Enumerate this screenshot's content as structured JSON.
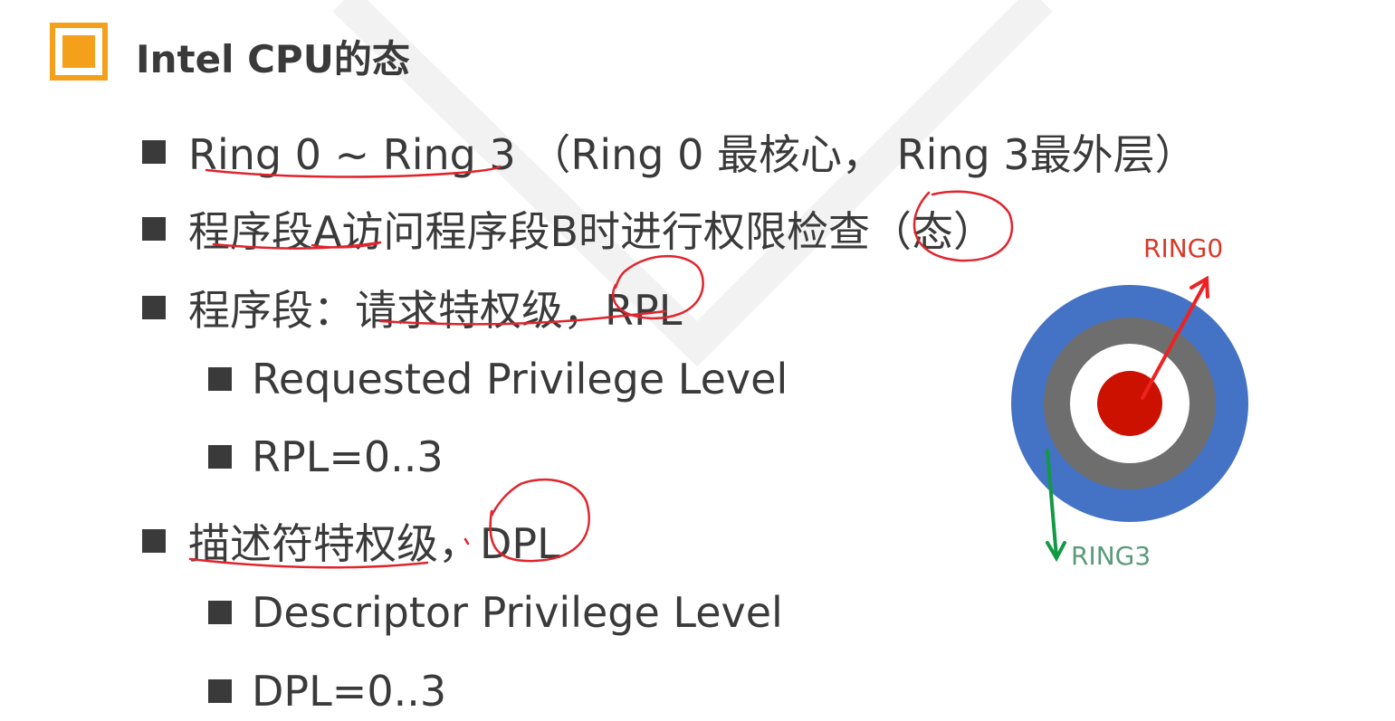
{
  "slide": {
    "title": "Intel CPU的态",
    "bullets": [
      {
        "level": 1,
        "text": "Ring 0 ~ Ring 3  （Ring 0 最核心， Ring 3最外层）"
      },
      {
        "level": 1,
        "text": "程序段A访问程序段B时进行权限检查（态）"
      },
      {
        "level": 1,
        "text": "程序段：请求特权级，RPL"
      },
      {
        "level": 2,
        "text": "Requested Privilege Level"
      },
      {
        "level": 2,
        "text": "RPL=0..3"
      },
      {
        "level": 1,
        "text": "描述符特权级，DPL"
      },
      {
        "level": 2,
        "text": "Descriptor Privilege Level"
      },
      {
        "level": 2,
        "text": "DPL=0..3"
      }
    ]
  },
  "diagram": {
    "label_ring0": "RING0",
    "label_ring3": "RING3"
  },
  "colors": {
    "accent": "#f5a01a",
    "ring_outer": "#4472c4",
    "ring_gray": "#6e6e6e",
    "ring_white": "#ffffff",
    "ring_core": "#cc1100",
    "arrow_red": "#ee2222",
    "arrow_green": "#119944",
    "label_ring0": "#d63a2a",
    "label_ring3": "#5a9a7a",
    "pen": "#e0242c"
  }
}
